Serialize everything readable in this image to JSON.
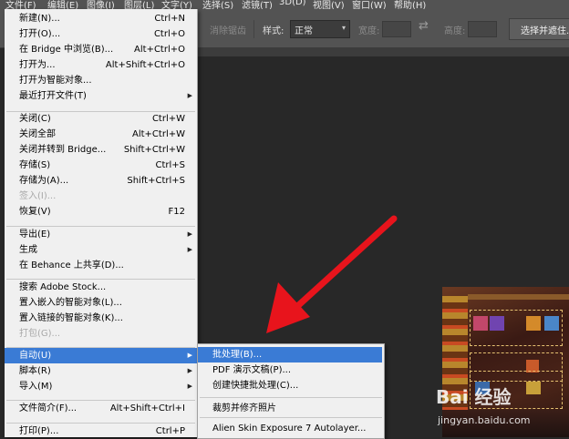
{
  "menubar": [
    {
      "label": "文件(F)"
    },
    {
      "label": "编辑(E)"
    },
    {
      "label": "图像(I)"
    },
    {
      "label": "图层(L)"
    },
    {
      "label": "文字(Y)"
    },
    {
      "label": "选择(S)"
    },
    {
      "label": "滤镜(T)"
    },
    {
      "label": "3D(D)"
    },
    {
      "label": "视图(V)"
    },
    {
      "label": "窗口(W)"
    },
    {
      "label": "帮助(H)"
    }
  ],
  "options": {
    "anti_alias": "消除锯齿",
    "style_label": "样式:",
    "style_value": "正常",
    "width_label": "宽度:",
    "height_label": "高度:",
    "select_mask": "选择并遮住..."
  },
  "file_menu": [
    {
      "label": "新建(N)...",
      "shortcut": "Ctrl+N"
    },
    {
      "label": "打开(O)...",
      "shortcut": "Ctrl+O"
    },
    {
      "label": "在 Bridge 中浏览(B)...",
      "shortcut": "Alt+Ctrl+O"
    },
    {
      "label": "打开为...",
      "shortcut": "Alt+Shift+Ctrl+O"
    },
    {
      "label": "打开为智能对象...",
      "shortcut": ""
    },
    {
      "label": "最近打开文件(T)",
      "shortcut": ""
    },
    {
      "label": "关闭(C)",
      "shortcut": "Ctrl+W"
    },
    {
      "label": "关闭全部",
      "shortcut": "Alt+Ctrl+W"
    },
    {
      "label": "关闭并转到 Bridge...",
      "shortcut": "Shift+Ctrl+W"
    },
    {
      "label": "存储(S)",
      "shortcut": "Ctrl+S"
    },
    {
      "label": "存储为(A)...",
      "shortcut": "Shift+Ctrl+S"
    },
    {
      "label": "签入(I)...",
      "shortcut": ""
    },
    {
      "label": "恢复(V)",
      "shortcut": "F12"
    },
    {
      "label": "导出(E)",
      "shortcut": ""
    },
    {
      "label": "生成",
      "shortcut": ""
    },
    {
      "label": "在 Behance 上共享(D)...",
      "shortcut": ""
    },
    {
      "label": "搜索 Adobe Stock...",
      "shortcut": ""
    },
    {
      "label": "置入嵌入的智能对象(L)...",
      "shortcut": ""
    },
    {
      "label": "置入链接的智能对象(K)...",
      "shortcut": ""
    },
    {
      "label": "打包(G)...",
      "shortcut": ""
    },
    {
      "label": "自动(U)",
      "shortcut": ""
    },
    {
      "label": "脚本(R)",
      "shortcut": ""
    },
    {
      "label": "导入(M)",
      "shortcut": ""
    },
    {
      "label": "文件简介(F)...",
      "shortcut": "Alt+Shift+Ctrl+I"
    },
    {
      "label": "打印(P)...",
      "shortcut": "Ctrl+P"
    }
  ],
  "auto_submenu": [
    {
      "label": "批处理(B)..."
    },
    {
      "label": "PDF 演示文稿(P)..."
    },
    {
      "label": "创建快捷批处理(C)..."
    },
    {
      "label": "裁剪并修齐照片"
    },
    {
      "label": "Alien Skin Exposure 7 Autolayer..."
    }
  ],
  "watermark": {
    "brand": "Bai 经验",
    "url": "jingyan.baidu.com"
  },
  "colors": {
    "menu_highlight": "#3a7bd5",
    "arrow": "#e8141c"
  }
}
